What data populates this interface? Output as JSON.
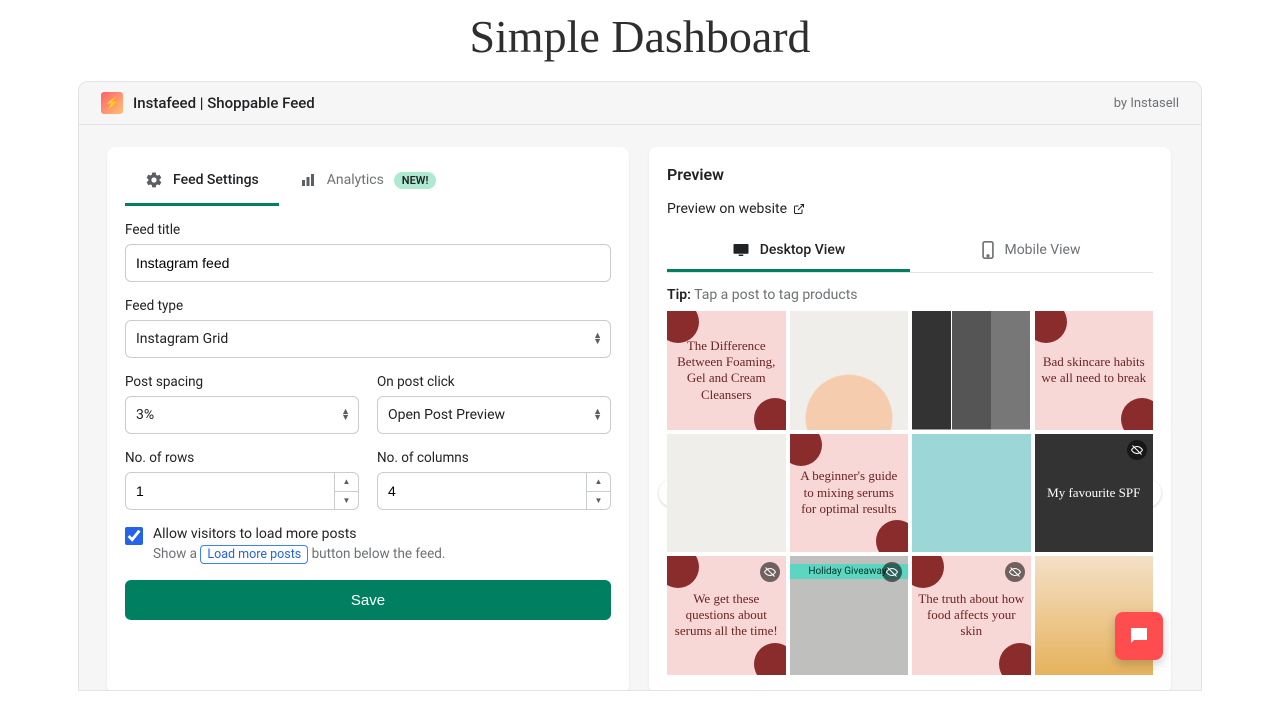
{
  "page_heading": "Simple Dashboard",
  "header": {
    "app_title": "Instafeed | Shoppable Feed",
    "by_prefix": "by",
    "vendor": "Instasell",
    "logo_glyph": "⚡"
  },
  "tabs": {
    "settings": "Feed Settings",
    "analytics": "Analytics",
    "new_badge": "NEW!"
  },
  "form": {
    "feed_title": {
      "label": "Feed title",
      "value": "Instagram feed"
    },
    "feed_type": {
      "label": "Feed type",
      "value": "Instagram Grid"
    },
    "post_spacing": {
      "label": "Post spacing",
      "value": "3%"
    },
    "on_post_click": {
      "label": "On post click",
      "value": "Open Post Preview"
    },
    "rows": {
      "label": "No. of rows",
      "value": "1"
    },
    "cols": {
      "label": "No. of columns",
      "value": "4"
    },
    "allow_more": {
      "label": "Allow visitors to load more posts",
      "desc_before": "Show a ",
      "chip": "Load more posts",
      "desc_after": " button below the feed."
    },
    "save": "Save"
  },
  "preview": {
    "title": "Preview",
    "link": "Preview on website",
    "desktop": "Desktop View",
    "mobile": "Mobile View",
    "tip_label": "Tip:",
    "tip_text": "Tap a post to tag products",
    "tiles": [
      {
        "text": "The Difference Between Foaming, Gel and Cream Cleansers",
        "klass": "pink-blob"
      },
      {
        "text": "",
        "klass": "hand"
      },
      {
        "text": "",
        "klass": "collage"
      },
      {
        "text": "Bad skincare habits we all need to break",
        "klass": "pink-blob"
      },
      {
        "text": "",
        "klass": "pale"
      },
      {
        "text": "A beginner's guide to mixing serums for optimal results",
        "klass": "pink-blob"
      },
      {
        "text": "",
        "klass": "teal"
      },
      {
        "text": "My favourite SPF",
        "klass": "dark",
        "hide": true
      },
      {
        "text": "We get these questions about serums all the time!",
        "klass": "pink-blob",
        "hide": true
      },
      {
        "text": "Holiday Giveaway!",
        "klass": "grey",
        "banner": true,
        "hide": true
      },
      {
        "text": "The truth about how food affects your skin",
        "klass": "pink-blob",
        "hide": true
      },
      {
        "text": "",
        "klass": "jar"
      }
    ]
  }
}
